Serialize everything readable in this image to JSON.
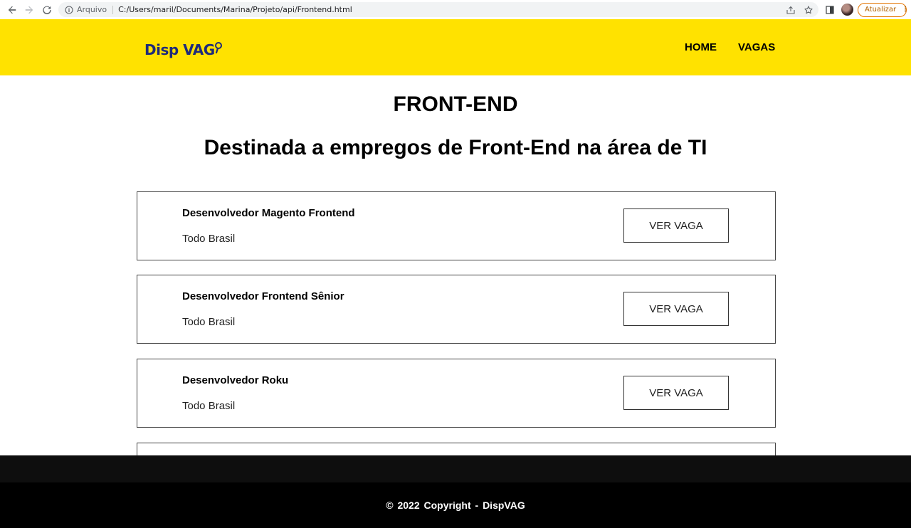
{
  "browser": {
    "scheme_label": "Arquivo",
    "url": "C:/Users/maril/Documents/Marina/Projeto/api/Frontend.html",
    "update_label": "Atualizar"
  },
  "header": {
    "logo_text": "Disp VAG",
    "brand_color": "#ffe200",
    "logo_color": "#1e2a7a",
    "nav": [
      {
        "label": "HOME"
      },
      {
        "label": "VAGAS"
      }
    ]
  },
  "main": {
    "title": "FRONT-END",
    "subtitle": "Destinada a empregos de Front-End na área de TI",
    "jobs": [
      {
        "title": "Desenvolvedor Magento Frontend",
        "location": "Todo Brasil",
        "button_label": "VER VAGA"
      },
      {
        "title": "Desenvolvedor Frontend Sênior",
        "location": "Todo Brasil",
        "button_label": "VER VAGA"
      },
      {
        "title": "Desenvolvedor Roku",
        "location": "Todo Brasil",
        "button_label": "VER VAGA"
      }
    ]
  },
  "footer": {
    "copyright": "© 2022 Copyright - DispVAG"
  }
}
